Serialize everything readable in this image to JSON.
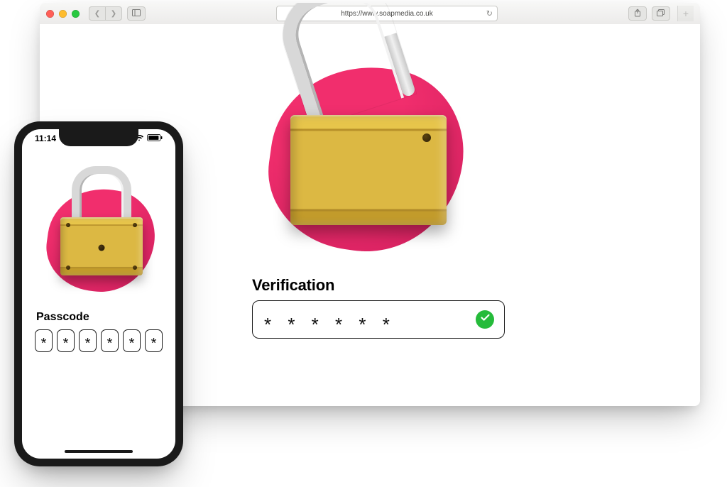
{
  "browser": {
    "url": "https://www.soapmedia.co.uk",
    "verification_label": "Verification",
    "verification_stars": "* * * * * *"
  },
  "phone": {
    "time": "11:14",
    "passcode_label": "Passcode",
    "passcode_cells": [
      "*",
      "*",
      "*",
      "*",
      "*",
      "*"
    ]
  }
}
